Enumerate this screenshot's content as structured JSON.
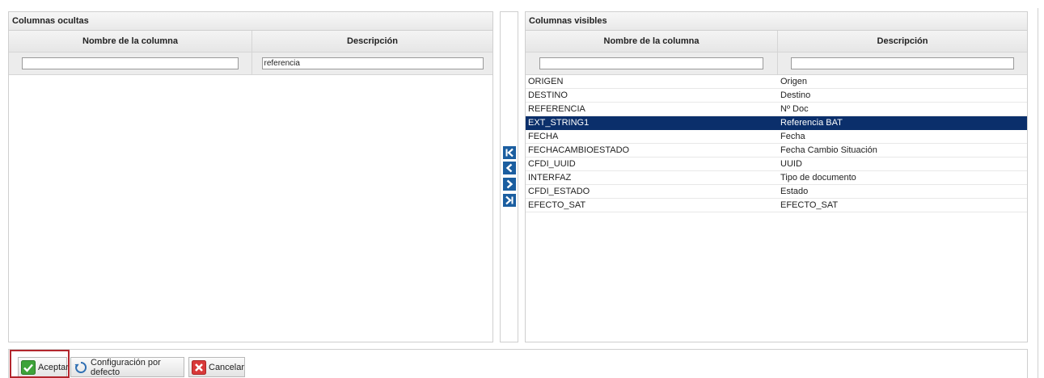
{
  "hidden_panel": {
    "title": "Columnas ocultas",
    "headers": [
      "Nombre de la columna",
      "Descripción"
    ],
    "filters": {
      "name": "",
      "description": "referencia"
    },
    "rows": []
  },
  "visible_panel": {
    "title": "Columnas visibles",
    "headers": [
      "Nombre de la columna",
      "Descripción"
    ],
    "filters": {
      "name": "",
      "description": ""
    },
    "rows": [
      {
        "name": "ORIGEN",
        "description": "Origen",
        "selected": false
      },
      {
        "name": "DESTINO",
        "description": "Destino",
        "selected": false
      },
      {
        "name": "REFERENCIA",
        "description": "Nº Doc",
        "selected": false
      },
      {
        "name": "EXT_STRING1",
        "description": "Referencia BAT",
        "selected": true
      },
      {
        "name": "FECHA",
        "description": "Fecha",
        "selected": false
      },
      {
        "name": "FECHACAMBIOESTADO",
        "description": "Fecha Cambio Situación",
        "selected": false
      },
      {
        "name": "CFDI_UUID",
        "description": "UUID",
        "selected": false
      },
      {
        "name": "INTERFAZ",
        "description": "Tipo de documento",
        "selected": false
      },
      {
        "name": "CFDI_ESTADO",
        "description": "Estado",
        "selected": false
      },
      {
        "name": "EFECTO_SAT",
        "description": "EFECTO_SAT",
        "selected": false
      }
    ]
  },
  "move_buttons": [
    "move-first-icon",
    "move-left-icon",
    "move-right-icon",
    "move-last-icon"
  ],
  "footer": {
    "accept_label": "Aceptar",
    "default_label": "Configuración por defecto",
    "cancel_label": "Cancelar"
  },
  "colors": {
    "selected_row": "#0b2f6b",
    "arrow_button": "#1b5ea0",
    "accept_icon": "#3ea33a",
    "cancel_icon": "#d93a3a",
    "focus_outline": "#b3262d"
  }
}
